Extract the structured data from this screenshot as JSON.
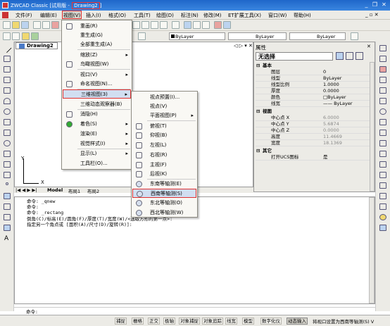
{
  "titlebar": {
    "prefix": "ZWCAD Classic [试用版 - ",
    "doc": "Drawing2",
    "suffix": "]",
    "min": "_",
    "max": "❐",
    "close": "✕"
  },
  "menubar": {
    "items": [
      "文件(F)",
      "编辑(E)",
      "视图(V)",
      "插入(I)",
      "格式(O)",
      "工具(T)",
      "绘图(D)",
      "标注(N)",
      "修改(M)",
      "ET扩展工具(X)",
      "窗口(W)",
      "帮助(H)"
    ],
    "right": "_ ▫ ✕"
  },
  "toolbar2": {
    "layer_label": "ByLayer",
    "linetype_label": "ByLayer",
    "lineweight_label": "ByLayer"
  },
  "drawing": {
    "tab": "Drawing2",
    "ctrl": "◁ ▷ ▾ ✕",
    "y_label": "Y",
    "x_label": "X",
    "layout_tabs": [
      "Model",
      "布局1",
      "布局2"
    ]
  },
  "view_menu": {
    "items": [
      {
        "label": "重画(R)"
      },
      {
        "label": "重生成(G)"
      },
      {
        "label": "全部重生成(A)"
      },
      {
        "label": "缩放(Z)",
        "sub": true
      },
      {
        "label": "鸟瞰视图(W)"
      },
      {
        "label": "视口(V)",
        "sub": true
      },
      {
        "label": "命名视图(N)..."
      },
      {
        "label": "三维视图(3)",
        "sub": true
      },
      {
        "label": "三维动态观察器(B)"
      },
      {
        "label": "消隐(H)"
      },
      {
        "label": "着色(S)",
        "sub": true
      },
      {
        "label": "渲染(E)",
        "sub": true
      },
      {
        "label": "视觉样式(I)",
        "sub": true
      },
      {
        "label": "显示(L)",
        "sub": true
      },
      {
        "label": "工具栏(O)..."
      }
    ]
  },
  "sub3d_menu": {
    "items": [
      {
        "label": "视点预置(I)..."
      },
      {
        "label": "视点(V)"
      },
      {
        "label": "平面视图(P)",
        "sub": true
      },
      {
        "label": "俯视(T)"
      },
      {
        "label": "仰视(B)"
      },
      {
        "label": "左视(L)"
      },
      {
        "label": "右视(R)"
      },
      {
        "label": "主视(F)"
      },
      {
        "label": "后视(K)"
      },
      {
        "label": "东南等轴测(E)"
      },
      {
        "label": "西南等轴测(S)"
      },
      {
        "label": "东北等轴测(O)"
      },
      {
        "label": "西北等轴测(W)"
      }
    ]
  },
  "properties": {
    "title": "属性",
    "close": "✕",
    "selection": "无选择",
    "rows": [
      {
        "k": "基本",
        "cat": true
      },
      {
        "k": "图层",
        "v": "0"
      },
      {
        "k": "线型",
        "v": "ByLayer"
      },
      {
        "k": "线型比例",
        "v": "1.0000"
      },
      {
        "k": "厚度",
        "v": "0.0000"
      },
      {
        "k": "颜色",
        "v": "□ByLayer"
      },
      {
        "k": "线宽",
        "v": "—— ByLayer"
      },
      {
        "k": "视图",
        "cat": true
      },
      {
        "k": "中心点 X",
        "v": "6.0000",
        "gray": true
      },
      {
        "k": "中心点 Y",
        "v": "5.6874",
        "gray": true
      },
      {
        "k": "中心点 Z",
        "v": "0.0000",
        "gray": true
      },
      {
        "k": "高度",
        "v": "11.4669",
        "gray": true
      },
      {
        "k": "宽度",
        "v": "18.1369",
        "gray": true
      },
      {
        "k": "其它",
        "cat": true
      },
      {
        "k": "打开UCS图标",
        "v": "是"
      }
    ]
  },
  "command": {
    "history": [
      "命令: _qnew",
      "命令:",
      "命令: _rectang",
      "倒角(C)/标高(E)/圆角(F)/厚度(T)/宽度(W)/<选取方形的第一点>:",
      "指定另一个角点或 [面积(A)/尺寸(D)/旋转(R)]:"
    ],
    "prompt": "命令:",
    "close": "✕"
  },
  "statusbar": {
    "buttons": [
      "捕捉",
      "栅格",
      "正交",
      "极轴",
      "对象捕捉",
      "对象追踪",
      "线宽",
      "模型",
      "数字化仪",
      "动态输入"
    ],
    "down_index": 9,
    "message": "将视口设置为西南等轴测(S)  V"
  }
}
